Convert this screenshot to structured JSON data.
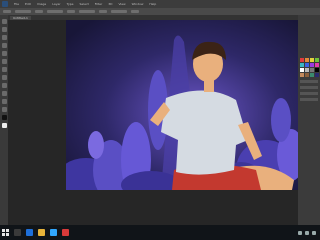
{
  "app": {
    "menu": [
      "File",
      "Edit",
      "Image",
      "Layer",
      "Type",
      "Select",
      "Filter",
      "3D",
      "View",
      "Window",
      "Help"
    ],
    "document_tab": "Untitled-1"
  },
  "colors": {
    "canvas_bg": "#1e1a3a",
    "accent": "#2a4e7a",
    "bush": "#5a4fc4",
    "shirt": "#d5dbe2",
    "shorts": "#c3392f",
    "skin": "#e9b07d",
    "hair": "#3b2316"
  },
  "swatches": [
    "#e23b3b",
    "#e28a3b",
    "#e2d43b",
    "#6ec23b",
    "#3bb6c2",
    "#3b5fe2",
    "#9a3be2",
    "#e23ba8",
    "#ffffff",
    "#bbbbbb",
    "#777777",
    "#000000",
    "#c38a5e",
    "#8a5e3b",
    "#3b8a6e",
    "#2a2a6e"
  ],
  "icons": {
    "start": "windows-start-icon",
    "tools": [
      "move-icon",
      "marquee-icon",
      "lasso-icon",
      "crop-icon",
      "eyedropper-icon",
      "brush-icon",
      "eraser-icon",
      "gradient-icon",
      "pen-icon",
      "text-icon",
      "hand-icon",
      "zoom-icon"
    ]
  }
}
